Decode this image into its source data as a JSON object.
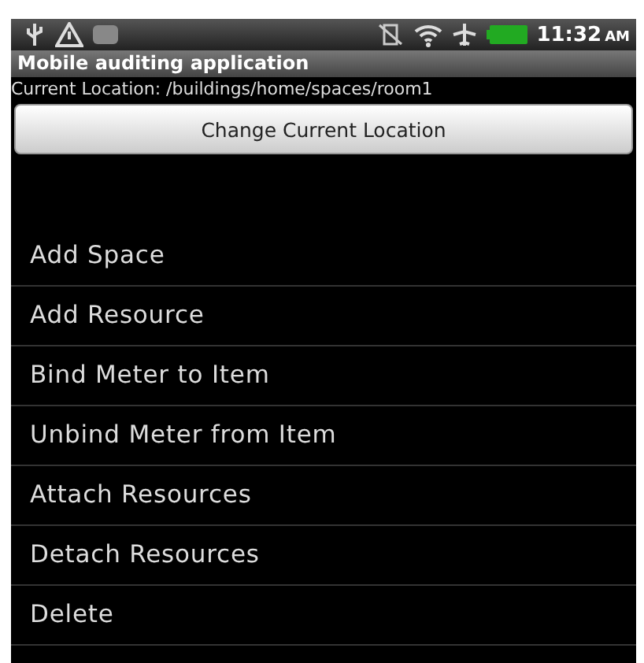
{
  "status_bar": {
    "time": "11:32",
    "meridiem": "AM"
  },
  "title_bar": {
    "title": "Mobile auditing application"
  },
  "location": {
    "text": "Current Location: /buildings/home/spaces/room1"
  },
  "button": {
    "label": "Change Current Location"
  },
  "menu": [
    {
      "label": "Add Space"
    },
    {
      "label": "Add Resource"
    },
    {
      "label": "Bind Meter to Item"
    },
    {
      "label": "Unbind Meter from Item"
    },
    {
      "label": "Attach Resources"
    },
    {
      "label": "Detach Resources"
    },
    {
      "label": "Delete"
    }
  ]
}
